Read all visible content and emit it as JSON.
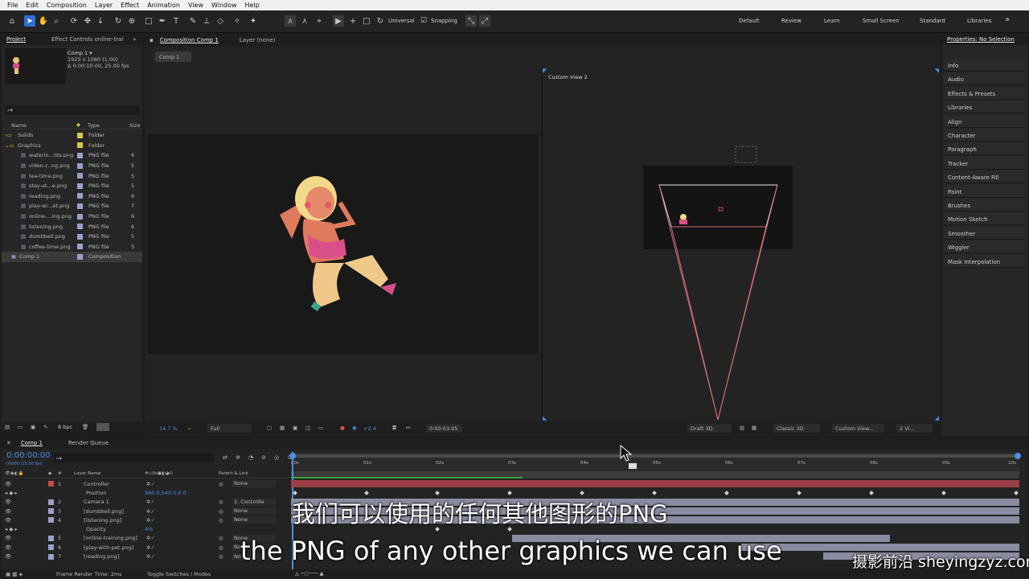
{
  "menu": [
    "File",
    "Edit",
    "Composition",
    "Layer",
    "Effect",
    "Animation",
    "View",
    "Window",
    "Help"
  ],
  "toolbar": {
    "universal": "Universal",
    "snapping": "Snapping",
    "workspaces": [
      "Default",
      "Review",
      "Learn",
      "Small Screen",
      "Standard",
      "Libraries"
    ]
  },
  "project": {
    "tab": "Project",
    "tab2": "Effect Controls online-trai",
    "comp_name": "Comp 1 ▾",
    "comp_info1": "1920 x 1080 (1.00)",
    "comp_info2": "Δ 0:00:10:00, 25.00 fps",
    "search": "⌕▾",
    "headers": {
      "name": "Name",
      "type": "Type",
      "size": "Size"
    },
    "items": [
      {
        "name": "Solids",
        "type": "Folder",
        "size": "",
        "color": "#d6c84a",
        "folder": true
      },
      {
        "name": "Graphics",
        "type": "Folder",
        "size": "",
        "color": "#d6c84a",
        "folder": true
      },
      {
        "name": "waterin...nts.png",
        "type": "PNG file",
        "size": "6",
        "color": "#9aa0c8"
      },
      {
        "name": "video-c..ng.png",
        "type": "PNG file",
        "size": "5",
        "color": "#9aa0c8"
      },
      {
        "name": "tea-time.png",
        "type": "PNG file",
        "size": "5",
        "color": "#9aa0c8"
      },
      {
        "name": "stay-at...e.png",
        "type": "PNG file",
        "size": "5",
        "color": "#9aa0c8"
      },
      {
        "name": "reading.png",
        "type": "PNG file",
        "size": "6",
        "color": "#9aa0c8"
      },
      {
        "name": "play-wi...et.png",
        "type": "PNG file",
        "size": "7",
        "color": "#9aa0c8"
      },
      {
        "name": "online-...ing.png",
        "type": "PNG file",
        "size": "6",
        "color": "#9aa0c8"
      },
      {
        "name": "listening.png",
        "type": "PNG file",
        "size": "6",
        "color": "#9aa0c8"
      },
      {
        "name": "dumbbell.png",
        "type": "PNG file",
        "size": "5",
        "color": "#9aa0c8"
      },
      {
        "name": "coffee-time.png",
        "type": "PNG file",
        "size": "5",
        "color": "#9aa0c8"
      },
      {
        "name": "Comp 1",
        "type": "Composition",
        "size": "",
        "color": "#9aa0c8",
        "selected": true
      }
    ],
    "bpc": "8 bpc"
  },
  "viewer": {
    "tab": "Composition Comp 1",
    "layer_tab": "Layer (none)",
    "subtab": "Comp 1",
    "custom_view": "Custom View 2",
    "zoom": "14.7 %",
    "resolution": "Full",
    "exposure": "+2.4",
    "timecode": "0:00:03:05",
    "draft": "Draft 3D",
    "renderer": "Classic 3D",
    "view": "Custom View...",
    "views": "2 Vi..."
  },
  "properties": {
    "title": "Properties: No Selection",
    "items": [
      "Info",
      "Audio",
      "Effects & Presets",
      "Libraries",
      "Align",
      "Character",
      "Paragraph",
      "Tracker",
      "Content-Aware Fill",
      "Paint",
      "Brushes",
      "Motion Sketch",
      "Smoother",
      "Wiggler",
      "Mask Interpolation"
    ]
  },
  "timeline": {
    "tab": "Comp 1",
    "tab2": "Render Queue",
    "timecode": "0:00:00:00",
    "fps": "00000 (25.00 fps)",
    "search": "⌕▾",
    "col_layer": "Layer Name",
    "col_parent": "Parent & Link",
    "ticks": [
      "00s",
      "01s",
      "02s",
      "03s",
      "04s",
      "05s",
      "06s",
      "07s",
      "08s",
      "09s",
      "10s"
    ],
    "layers": [
      {
        "num": "1",
        "name": "Controller",
        "parent": "None",
        "color": "#c94a4a"
      },
      {
        "num": "",
        "name": "Position",
        "value": "960.0,540.0,0.0",
        "prop": true
      },
      {
        "num": "2",
        "name": "Camera 1",
        "parent": "1. Controlle",
        "color": "#9aa0c8"
      },
      {
        "num": "3",
        "name": "[dumbbell.png]",
        "parent": "None",
        "color": "#9aa0c8"
      },
      {
        "num": "4",
        "name": "[listening.png]",
        "parent": "None",
        "color": "#9aa0c8"
      },
      {
        "num": "",
        "name": "Opacity",
        "value": "4%",
        "prop": true
      },
      {
        "num": "5",
        "name": "[online-training.png]",
        "parent": "None",
        "color": "#9aa0c8"
      },
      {
        "num": "6",
        "name": "[play-with-pet.png]",
        "parent": "No",
        "color": "#9aa0c8"
      },
      {
        "num": "7",
        "name": "[reading.png]",
        "parent": "No",
        "color": "#9aa0c8"
      }
    ],
    "footer_left": "Frame Render Time: 2ms",
    "footer_mid": "Toggle Switches / Modes"
  },
  "subtitle": {
    "zh": "我们可以使用的任何其他图形的PNG",
    "en": "the PNG of any other graphics we can use"
  },
  "watermark": "摄影前沿 sheyingzyz.com"
}
